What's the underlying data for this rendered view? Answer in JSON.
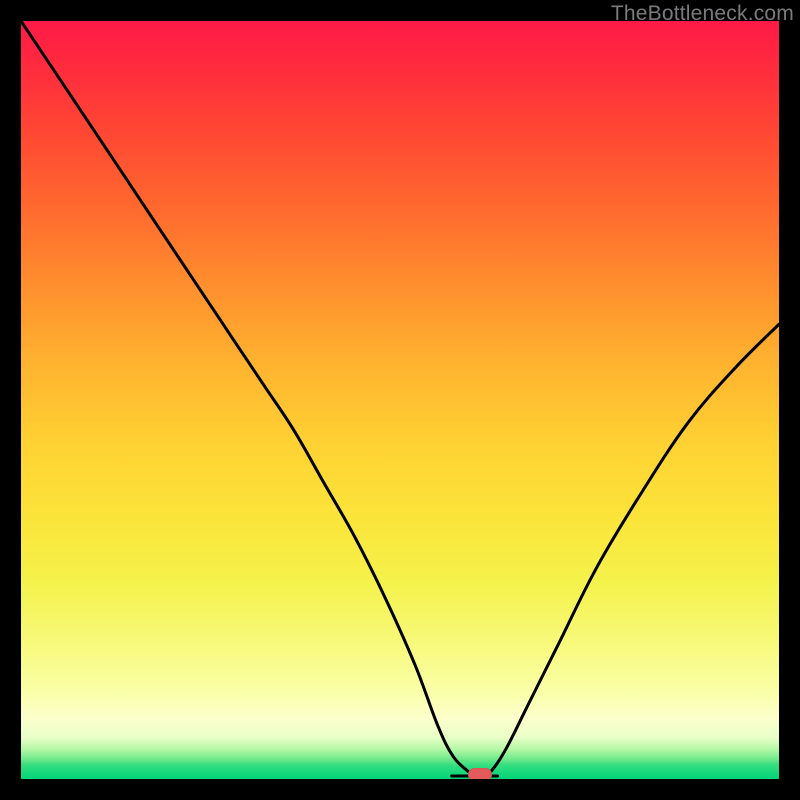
{
  "watermark": "TheBottleneck.com",
  "colors": {
    "frame": "#000000",
    "curve": "#000000",
    "minPoint": "#e25a5a"
  },
  "chart_data": {
    "type": "line",
    "title": "",
    "xlabel": "",
    "ylabel": "",
    "xlim": [
      0,
      100
    ],
    "ylim": [
      0,
      100
    ],
    "grid": false,
    "legend": false,
    "background": "red-yellow-green vertical gradient (bottleneck heat)",
    "series": [
      {
        "name": "bottleneck-curve",
        "x": [
          0,
          6,
          12,
          18,
          24,
          28,
          32,
          36,
          40,
          44,
          48,
          52,
          55,
          57,
          59,
          60.5,
          62,
          64,
          67,
          71,
          76,
          82,
          88,
          94,
          100
        ],
        "y": [
          100,
          91,
          82,
          73,
          64,
          58,
          52,
          46,
          39,
          32,
          24,
          15,
          7,
          3,
          1,
          0,
          1,
          4,
          10,
          18,
          28,
          38,
          47,
          54,
          60
        ]
      }
    ],
    "annotations": [
      {
        "name": "optimal-point",
        "x": 60.5,
        "y": 0,
        "shape": "rounded-rect",
        "color": "#e25a5a"
      }
    ],
    "notes": "Axes have no visible tick labels; values are normalized 0–100. y=0 corresponds to the bottom (green) edge, y=100 the top (red) edge."
  }
}
